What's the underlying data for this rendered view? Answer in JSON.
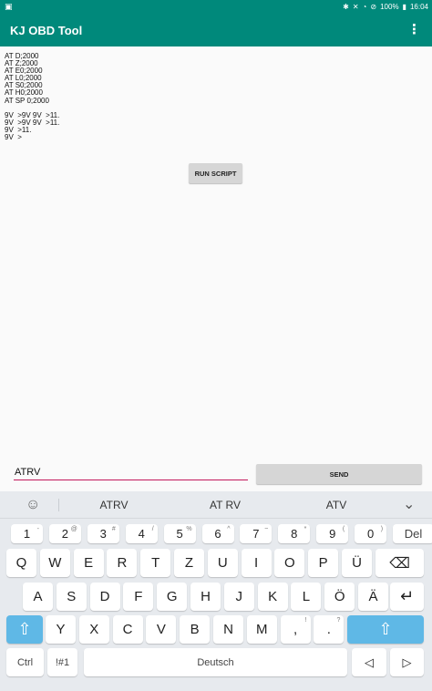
{
  "status_bar": {
    "left_icon": "image-icon",
    "battery": "100%",
    "time": "16:04"
  },
  "app_bar": {
    "title": "KJ OBD Tool",
    "menu_icon": "more-vert-icon"
  },
  "log": {
    "lines": [
      "AT D;2000",
      "AT Z;2000",
      "AT E0;2000",
      "AT L0;2000",
      "AT S0;2000",
      "AT H0;2000",
      "AT SP 0;2000",
      "",
      "9V  >9V 9V  >11.",
      "9V  >9V 9V  >11.",
      "9V  >11.",
      "9V  >"
    ]
  },
  "run_button": {
    "label": "RUN SCRIPT"
  },
  "command_input": {
    "value": "ATRV",
    "placeholder": ""
  },
  "send_button": {
    "label": "SEND"
  },
  "keyboard": {
    "suggestions": [
      "ATRV",
      "AT RV",
      "ATV"
    ],
    "number_row": [
      {
        "label": "1",
        "sub": "-"
      },
      {
        "label": "2",
        "sub": "@"
      },
      {
        "label": "3",
        "sub": "#"
      },
      {
        "label": "4",
        "sub": "/"
      },
      {
        "label": "5",
        "sub": "%"
      },
      {
        "label": "6",
        "sub": "^"
      },
      {
        "label": "7",
        "sub": "~"
      },
      {
        "label": "8",
        "sub": "*"
      },
      {
        "label": "9",
        "sub": "("
      },
      {
        "label": "0",
        "sub": ")"
      },
      {
        "label": "Del",
        "sub": ""
      }
    ],
    "row1": [
      "Q",
      "W",
      "E",
      "R",
      "T",
      "Z",
      "U",
      "I",
      "O",
      "P",
      "Ü"
    ],
    "row2": [
      "A",
      "S",
      "D",
      "F",
      "G",
      "H",
      "J",
      "K",
      "L",
      "Ö",
      "Ä"
    ],
    "row3": [
      "Y",
      "X",
      "C",
      "V",
      "B",
      "N",
      "M",
      ",",
      "."
    ],
    "row3_subs": {
      ",": "!",
      ".": "?"
    },
    "ctrl_label": "Ctrl",
    "symbols_label": "!#1",
    "space_label": "Deutsch"
  },
  "colors": {
    "app_bar": "#00897b",
    "input_underline": "#c2185b",
    "shift_key": "#5fb8e6"
  }
}
